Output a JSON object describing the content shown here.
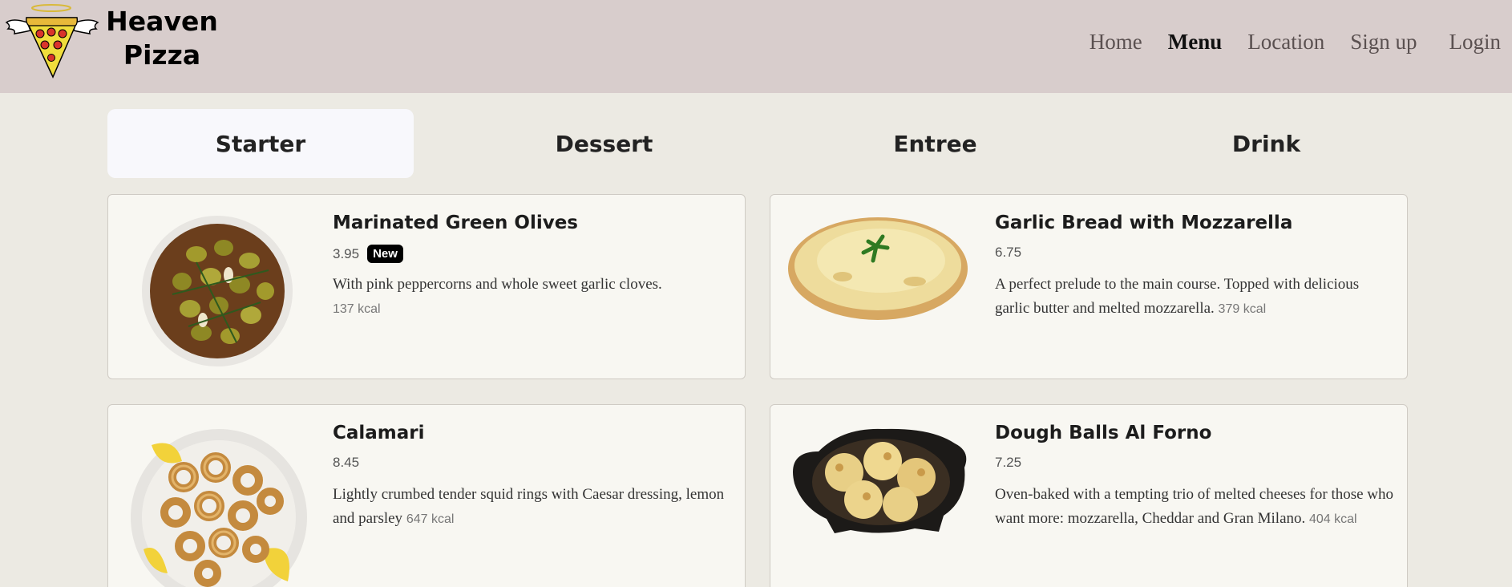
{
  "brand": {
    "line1": "Heaven",
    "line2": "Pizza"
  },
  "nav": [
    {
      "label": "Home"
    },
    {
      "label": "Menu"
    },
    {
      "label": "Location"
    },
    {
      "label": "Sign up"
    },
    {
      "label": "Login"
    }
  ],
  "tabs": [
    {
      "label": "Starter"
    },
    {
      "label": "Dessert"
    },
    {
      "label": "Entree"
    },
    {
      "label": "Drink"
    }
  ],
  "items": [
    {
      "title": "Marinated Green Olives",
      "price": "3.95",
      "badge": "New",
      "description": "With pink peppercorns and whole sweet garlic cloves.",
      "kcal": "137 kcal"
    },
    {
      "title": "Garlic Bread with Mozzarella",
      "price": "6.75",
      "description": "A perfect prelude to the main course. Topped with delicious garlic butter and melted mozzarella.",
      "kcal": "379 kcal"
    },
    {
      "title": "Calamari",
      "price": "8.45",
      "description": "Lightly crumbed tender squid rings with Caesar dressing, lemon and parsley",
      "kcal": "647 kcal"
    },
    {
      "title": "Dough Balls Al Forno",
      "price": "7.25",
      "description": "Oven-baked with a tempting trio of melted cheeses for those who want more: mozzarella, Cheddar and Gran Milano.",
      "kcal": "404 kcal"
    }
  ],
  "colors": {
    "header_bg": "#d8cdcc",
    "page_bg": "#eceae3",
    "card_bg": "#f8f7f2",
    "active_tab_bg": "#f8f8fc",
    "badge_bg": "#000000"
  }
}
